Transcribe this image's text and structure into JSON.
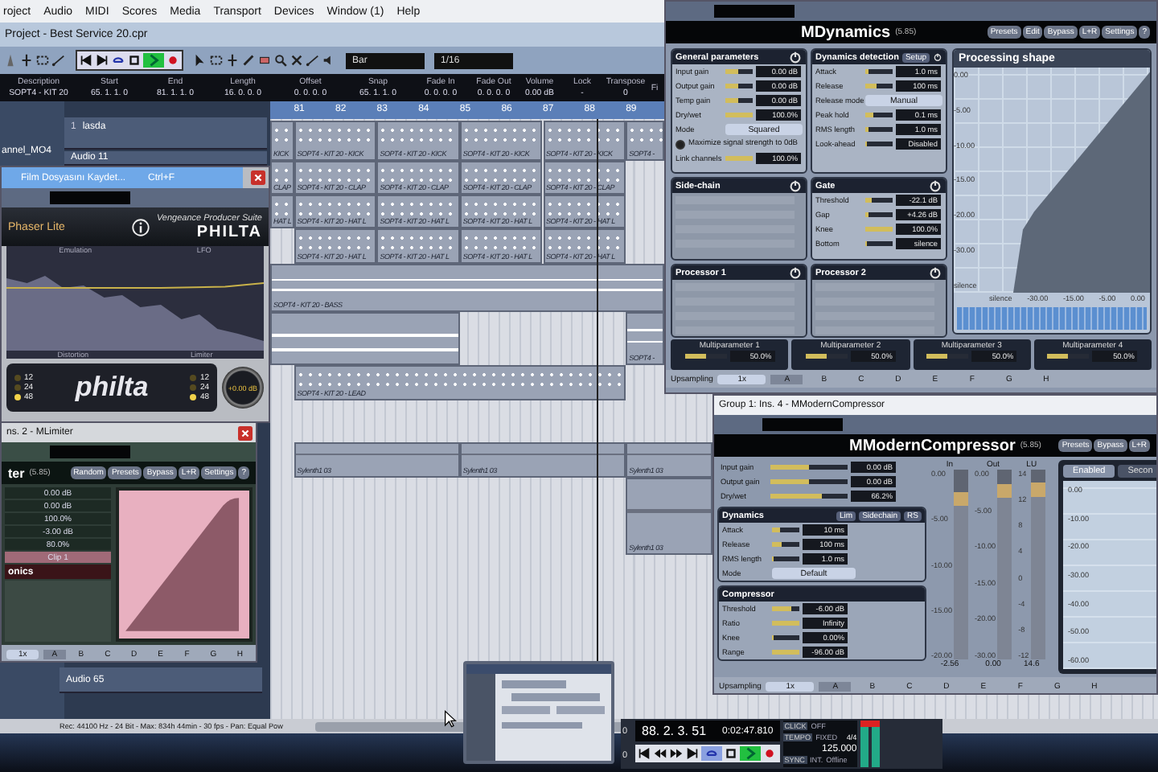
{
  "menu": [
    "roject",
    "Audio",
    "MIDI",
    "Scores",
    "Media",
    "Transport",
    "Devices",
    "Window (1)",
    "Help"
  ],
  "project_title": "Project - Best Service 20.cpr",
  "toolbar": {
    "fields": [
      {
        "value": "Bar"
      },
      {
        "value": "1/16"
      }
    ]
  },
  "info_line": [
    {
      "header": "Description",
      "value": "SOPT4 - KIT 20"
    },
    {
      "header": "Start",
      "value": "65. 1. 1. 0"
    },
    {
      "header": "End",
      "value": "81. 1. 1. 0"
    },
    {
      "header": "Length",
      "value": "16. 0. 0. 0"
    },
    {
      "header": "Offset",
      "value": "0. 0. 0. 0"
    },
    {
      "header": "Snap",
      "value": "65. 1. 1. 0"
    },
    {
      "header": "Fade In",
      "value": "0. 0. 0. 0"
    },
    {
      "header": "Fade Out",
      "value": "0. 0. 0. 0"
    },
    {
      "header": "Volume",
      "value": "0.00 dB"
    },
    {
      "header": "Lock",
      "value": "-"
    },
    {
      "header": "Transpose",
      "value": "0"
    },
    {
      "header": "Fi"
    }
  ],
  "inspector_label": "annel_MO4",
  "tracks": [
    {
      "number": "1",
      "name": "lasda"
    },
    {
      "name": "Audio 11"
    },
    {
      "name": "Audio 65"
    }
  ],
  "ruler": [
    "81",
    "82",
    "83",
    "84",
    "85",
    "86",
    "87",
    "88",
    "89"
  ],
  "lanes": [
    {
      "kind": "midi",
      "parts": [
        {
          "label": "KICK"
        },
        {
          "label": "SOPT4 - KIT 20 - KICK"
        },
        {
          "label": "SOPT4 - KIT 20 - KICK"
        },
        {
          "label": "SOPT4 - KIT 20 - KICK"
        },
        {
          "label": "SOPT4 - KIT 20 - KICK"
        },
        {
          "label": "SOPT4 -"
        }
      ]
    },
    {
      "kind": "midi",
      "parts": [
        {
          "label": "CLAP"
        },
        {
          "label": "SOPT4 - KIT 20 - CLAP"
        },
        {
          "label": "SOPT4 - KIT 20 - CLAP"
        },
        {
          "label": "SOPT4 - KIT 20 - CLAP"
        },
        {
          "label": "SOPT4 - KIT 20 - CLAP"
        }
      ]
    },
    {
      "kind": "midi",
      "parts": [
        {
          "label": "HAT L"
        },
        {
          "label": "SOPT4 - KIT 20 - HAT L"
        },
        {
          "label": "SOPT4 - KIT 20 - HAT L"
        },
        {
          "label": "SOPT4 - KIT 20 - HAT L"
        },
        {
          "label": "SOPT4 - KIT 20 - HAT L"
        }
      ]
    },
    {
      "kind": "midi",
      "parts": [
        {
          "label": "SOPT4 - KIT 20 - HAT L"
        },
        {
          "label": "SOPT4 - KIT 20 - HAT L"
        },
        {
          "label": "SOPT4 - KIT 20 - HAT L"
        },
        {
          "label": "SOPT4 - KIT 20 - HAT L"
        }
      ]
    },
    {
      "kind": "audio",
      "parts": [
        {
          "label": "SOPT4 - KIT 20 - BASS"
        }
      ]
    },
    {
      "parts": [
        {
          "kind": "audio"
        },
        {
          "kind": "audio",
          "label": "SOPT4 -"
        }
      ]
    },
    {
      "kind": "midi",
      "parts": [
        {
          "label": "SOPT4 - KIT 20 - LEAD"
        }
      ]
    },
    {
      "kind": "synth",
      "parts": [
        {
          "label": "Sylenth1 03"
        },
        {
          "label": "Sylenth1 03"
        },
        {
          "label": "Sylenth1 03"
        }
      ]
    },
    {
      "kind": "synth",
      "parts": [
        {
          "label": "Sylenth1 03"
        }
      ]
    }
  ],
  "status_bar": "Rec: 44100 Hz - 24 Bit - Max: 834h 44min - 30 fps - Pan: Equal Pow",
  "mdynamics": {
    "title": "MDynamics",
    "version": "(5.85)",
    "buttons": [
      "Presets",
      "Edit",
      "Bypass",
      "L+R",
      "Settings",
      "?"
    ],
    "panels": [
      {
        "title": "General parameters",
        "enabled": true,
        "params": [
          {
            "kind": "slider",
            "label": "Input gain",
            "value": "0.00 dB",
            "level": 0.45
          },
          {
            "kind": "slider",
            "label": "Output gain",
            "value": "0.00 dB",
            "level": 0.45
          },
          {
            "kind": "slider",
            "label": "Temp gain",
            "value": "0.00 dB",
            "level": 0.45
          },
          {
            "kind": "slider",
            "label": "Dry/wet",
            "value": "100.0%",
            "level": 1
          },
          {
            "kind": "select",
            "label": "Mode",
            "value": "Squared"
          },
          {
            "kind": "option",
            "label": "Maximize signal strength to 0dB",
            "checked": true
          },
          {
            "kind": "slider",
            "label": "Link channels",
            "value": "100.0%",
            "level": 1
          }
        ]
      },
      {
        "title": "Dynamics detection",
        "button": "Setup",
        "enabled": true,
        "params": [
          {
            "kind": "slider",
            "label": "Attack",
            "value": "1.0 ms",
            "level": 0.1
          },
          {
            "kind": "slider",
            "label": "Release",
            "value": "100 ms",
            "level": 0.4
          },
          {
            "kind": "select",
            "label": "Release mode",
            "value": "Manual"
          },
          {
            "kind": "slider",
            "label": "Peak hold",
            "value": "0.1 ms",
            "level": 0.3
          },
          {
            "kind": "slider",
            "label": "RMS length",
            "value": "1.0 ms",
            "level": 0.1
          },
          {
            "kind": "slider",
            "label": "Look-ahead",
            "value": "Disabled",
            "level": 0
          }
        ]
      },
      {
        "title": "Side-chain",
        "enabled": false
      },
      {
        "title": "Gate",
        "enabled": true,
        "params": [
          {
            "kind": "slider",
            "label": "Threshold",
            "value": "-22.1 dB",
            "level": 0.25
          },
          {
            "kind": "slider",
            "label": "Gap",
            "value": "+4.26 dB",
            "level": 0.1
          },
          {
            "kind": "slider",
            "label": "Knee",
            "value": "100.0%",
            "level": 1
          },
          {
            "kind": "slider",
            "label": "Bottom",
            "value": "silence",
            "level": 0
          }
        ]
      },
      {
        "title": "Processor 1",
        "enabled": false
      },
      {
        "title": "Processor 2",
        "enabled": false
      }
    ],
    "graph": {
      "title": "Processing shape",
      "y_labels": [
        "0.00",
        "-5.00",
        "-10.00",
        "-15.00",
        "-20.00",
        "-30.00",
        "silence"
      ],
      "x_labels": [
        "silence",
        "-30.00",
        "-15.00",
        "-5.00",
        "0.00"
      ]
    },
    "multiparameters": [
      {
        "label": "Multiparameter 1",
        "value": "50.0%",
        "level": 0.5
      },
      {
        "label": "Multiparameter 2",
        "value": "50.0%",
        "level": 0.5
      },
      {
        "label": "Multiparameter 3",
        "value": "50.0%",
        "level": 0.5
      },
      {
        "label": "Multiparameter 4",
        "value": "50.0%",
        "level": 0.5
      }
    ],
    "upsampling_label": "Upsampling",
    "upsampling": "1x",
    "slots": [
      {
        "label": "A",
        "selected": true
      },
      {
        "label": "B",
        "selected": false
      },
      {
        "label": "C",
        "selected": false
      },
      {
        "label": "D",
        "selected": false
      },
      {
        "label": "E",
        "selected": false
      },
      {
        "label": "F",
        "selected": false
      },
      {
        "label": "G",
        "selected": false
      },
      {
        "label": "H",
        "selected": false
      }
    ]
  },
  "mcompressor": {
    "window_title": "Group 1: Ins. 4 - MModernCompressor",
    "title": "MModernCompressor",
    "version": "(5.85)",
    "buttons": [
      "Presets",
      "Bypass",
      "L+R"
    ],
    "params": [
      {
        "label": "Input gain",
        "value": "0.00 dB",
        "level": 0.5
      },
      {
        "label": "Output gain",
        "value": "0.00 dB",
        "level": 0.5
      },
      {
        "label": "Dry/wet",
        "value": "66.2%",
        "level": 0.66
      }
    ],
    "panels": [
      {
        "title": "Dynamics",
        "buttons": [
          "Lim",
          "Sidechain",
          "RS"
        ],
        "params": [
          {
            "kind": "slider",
            "label": "Attack",
            "value": "10 ms",
            "level": 0.3
          },
          {
            "kind": "slider",
            "label": "Release",
            "value": "100 ms",
            "level": 0.35
          },
          {
            "kind": "slider",
            "label": "RMS length",
            "value": "1.0 ms",
            "level": 0.08
          },
          {
            "kind": "select",
            "label": "Mode",
            "value": "Default"
          }
        ]
      },
      {
        "title": "Compressor",
        "params": [
          {
            "kind": "slider",
            "label": "Threshold",
            "value": "-6.00 dB",
            "level": 0.7
          },
          {
            "kind": "slider",
            "label": "Ratio",
            "value": "Infinity",
            "level": 1
          },
          {
            "kind": "slider",
            "label": "Knee",
            "value": "0.00%",
            "level": 0
          },
          {
            "kind": "slider",
            "label": "Range",
            "value": "-96.00 dB",
            "level": 1
          }
        ]
      }
    ],
    "meters": [
      {
        "name": "In",
        "scale": [
          "0.00",
          "-5.00",
          "-10.00",
          "-15.00",
          "-20.00"
        ],
        "reading": "-2.56",
        "level": 0.88
      },
      {
        "name": "Out",
        "scale": [
          "0.00",
          "-5.00",
          "-10.00",
          "-15.00",
          "-20.00",
          "-30.00"
        ],
        "reading": "0.00",
        "level": 0.92
      },
      {
        "name": "LU",
        "scale": [
          "14",
          "12",
          "8",
          "4",
          "0",
          "-4",
          "-8",
          "-12"
        ],
        "reading": "14.6",
        "level": 0.93
      }
    ],
    "graph_tabs": [
      {
        "label": "Enabled",
        "selected": true
      },
      {
        "label": "Secon",
        "selected": false
      }
    ],
    "graph_labels": [
      "0.00",
      "-10.00",
      "-20.00",
      "-30.00",
      "-40.00",
      "-50.00",
      "-60.00"
    ],
    "upsampling_label": "Upsampling",
    "upsampling": "1x",
    "slots": [
      {
        "label": "A",
        "selected": true
      },
      {
        "label": "B",
        "selected": false
      },
      {
        "label": "C",
        "selected": false
      },
      {
        "label": "D",
        "selected": false
      },
      {
        "label": "E",
        "selected": false
      },
      {
        "label": "F",
        "selected": false
      },
      {
        "label": "G",
        "selected": false
      },
      {
        "label": "H",
        "selected": false
      }
    ]
  },
  "philta": {
    "menu_item": {
      "label": "Film Dosyasını Kaydet...",
      "shortcut": "Ctrl+F"
    },
    "preset": "Phaser Lite",
    "suite": "Vengeance Producer Suite",
    "name": "PHILTA",
    "top_labels": [
      "Emulation",
      "LFO"
    ],
    "bottom_labels": [
      "Distortion",
      "Limiter"
    ],
    "slopes": [
      [
        {
          "label": "12",
          "on": false
        },
        {
          "label": "24",
          "on": false
        },
        {
          "label": "48",
          "on": true
        }
      ],
      [
        {
          "label": "12",
          "on": false
        },
        {
          "label": "24",
          "on": false
        },
        {
          "label": "48",
          "on": true
        }
      ]
    ],
    "logo": "philta",
    "knob_value": "+0.00 dB"
  },
  "mlimiter": {
    "window_title": "ns. 2 - MLimiter",
    "title": "ter",
    "version": "(5.85)",
    "buttons": [
      "Random",
      "Presets",
      "Bypass",
      "L+R",
      "Settings",
      "?"
    ],
    "values": [
      "0.00 dB",
      "0.00 dB",
      "100.0%",
      "-3.00 dB",
      "80.0%"
    ],
    "mode": "Clip 1",
    "section": "onics",
    "upsampling": "1x",
    "slots": [
      {
        "label": "A",
        "selected": true
      },
      {
        "label": "B",
        "selected": false
      },
      {
        "label": "C",
        "selected": false
      },
      {
        "label": "D",
        "selected": false
      },
      {
        "label": "E",
        "selected": false
      },
      {
        "label": "F",
        "selected": false
      },
      {
        "label": "G",
        "selected": false
      },
      {
        "label": "H",
        "selected": false
      }
    ]
  },
  "transport": {
    "counters": [
      "0",
      "0"
    ],
    "position": "88. 2. 3. 51",
    "time": "0:02:47.810",
    "click": [
      "CLICK",
      "OFF"
    ],
    "tempo": [
      "TEMPO",
      "FIXED"
    ],
    "signature": "4/4",
    "bpm": "125.000",
    "sync": [
      "SYNC",
      "INT."
    ],
    "offline": "Offline"
  }
}
